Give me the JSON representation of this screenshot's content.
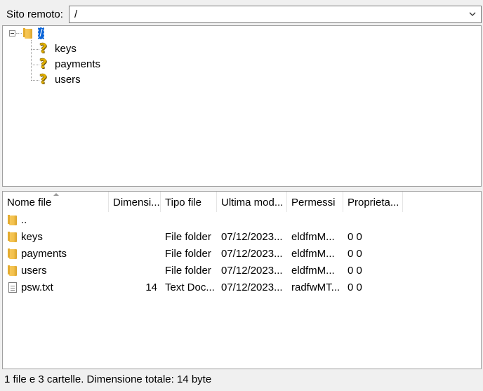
{
  "remote_site": {
    "label": "Sito remoto:",
    "path": "/"
  },
  "tree": {
    "root_label": "/",
    "children": [
      {
        "label": "keys",
        "icon": "question-mark-icon"
      },
      {
        "label": "payments",
        "icon": "question-mark-icon"
      },
      {
        "label": "users",
        "icon": "question-mark-icon"
      }
    ]
  },
  "file_list": {
    "columns": [
      "Nome file",
      "Dimensi...",
      "Tipo file",
      "Ultima mod...",
      "Permessi",
      "Proprieta..."
    ],
    "sorted_column": "Nome file",
    "rows": [
      {
        "name": "..",
        "size": "",
        "type": "",
        "modified": "",
        "permissions": "",
        "owner": "",
        "icon": "folder-icon"
      },
      {
        "name": "keys",
        "size": "",
        "type": "File folder",
        "modified": "07/12/2023...",
        "permissions": "eldfmM...",
        "owner": "0 0",
        "icon": "folder-icon"
      },
      {
        "name": "payments",
        "size": "",
        "type": "File folder",
        "modified": "07/12/2023...",
        "permissions": "eldfmM...",
        "owner": "0 0",
        "icon": "folder-icon"
      },
      {
        "name": "users",
        "size": "",
        "type": "File folder",
        "modified": "07/12/2023...",
        "permissions": "eldfmM...",
        "owner": "0 0",
        "icon": "folder-icon"
      },
      {
        "name": "psw.txt",
        "size": "14",
        "type": "Text Doc...",
        "modified": "07/12/2023...",
        "permissions": "radfwMT...",
        "owner": "0 0",
        "icon": "text-file-icon"
      }
    ]
  },
  "status": {
    "text": "1 file e 3 cartelle. Dimensione totale: 14 byte"
  }
}
